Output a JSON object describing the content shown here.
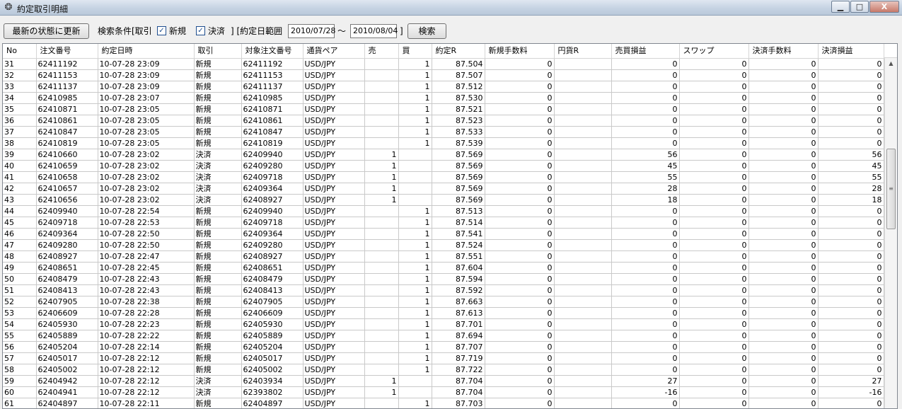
{
  "window": {
    "title": "約定取引明細",
    "icon": "app-icon",
    "minimize": "▁",
    "maximize": "□",
    "close": "X"
  },
  "toolbar": {
    "refresh_label": "最新の状態に更新",
    "filter_label": "検索条件[取引",
    "new_label": "新規",
    "settle_label": "決済",
    "range_label": "] [約定日範囲",
    "date_from": "2010/07/28",
    "tilde": "～",
    "date_to": "2010/08/04",
    "range_close": "]",
    "search_label": "検索",
    "checkbox_mark": "✓"
  },
  "table": {
    "columns": [
      "No",
      "注文番号",
      "約定日時",
      "取引",
      "対象注文番号",
      "通貨ペア",
      "売",
      "買",
      "約定R",
      "新規手数料",
      "円貨R",
      "売買損益",
      "スワップ",
      "決済手数料",
      "決済損益"
    ],
    "rows": [
      [
        "31",
        "62411192",
        "10-07-28 23:09",
        "新規",
        "62411192",
        "USD/JPY",
        "",
        "1",
        "87.504",
        "0",
        "",
        "0",
        "0",
        "0",
        "0"
      ],
      [
        "32",
        "62411153",
        "10-07-28 23:09",
        "新規",
        "62411153",
        "USD/JPY",
        "",
        "1",
        "87.507",
        "0",
        "",
        "0",
        "0",
        "0",
        "0"
      ],
      [
        "33",
        "62411137",
        "10-07-28 23:09",
        "新規",
        "62411137",
        "USD/JPY",
        "",
        "1",
        "87.512",
        "0",
        "",
        "0",
        "0",
        "0",
        "0"
      ],
      [
        "34",
        "62410985",
        "10-07-28 23:07",
        "新規",
        "62410985",
        "USD/JPY",
        "",
        "1",
        "87.530",
        "0",
        "",
        "0",
        "0",
        "0",
        "0"
      ],
      [
        "35",
        "62410871",
        "10-07-28 23:05",
        "新規",
        "62410871",
        "USD/JPY",
        "",
        "1",
        "87.521",
        "0",
        "",
        "0",
        "0",
        "0",
        "0"
      ],
      [
        "36",
        "62410861",
        "10-07-28 23:05",
        "新規",
        "62410861",
        "USD/JPY",
        "",
        "1",
        "87.523",
        "0",
        "",
        "0",
        "0",
        "0",
        "0"
      ],
      [
        "37",
        "62410847",
        "10-07-28 23:05",
        "新規",
        "62410847",
        "USD/JPY",
        "",
        "1",
        "87.533",
        "0",
        "",
        "0",
        "0",
        "0",
        "0"
      ],
      [
        "38",
        "62410819",
        "10-07-28 23:05",
        "新規",
        "62410819",
        "USD/JPY",
        "",
        "1",
        "87.539",
        "0",
        "",
        "0",
        "0",
        "0",
        "0"
      ],
      [
        "39",
        "62410660",
        "10-07-28 23:02",
        "決済",
        "62409940",
        "USD/JPY",
        "1",
        "",
        "87.569",
        "0",
        "",
        "56",
        "0",
        "0",
        "56"
      ],
      [
        "40",
        "62410659",
        "10-07-28 23:02",
        "決済",
        "62409280",
        "USD/JPY",
        "1",
        "",
        "87.569",
        "0",
        "",
        "45",
        "0",
        "0",
        "45"
      ],
      [
        "41",
        "62410658",
        "10-07-28 23:02",
        "決済",
        "62409718",
        "USD/JPY",
        "1",
        "",
        "87.569",
        "0",
        "",
        "55",
        "0",
        "0",
        "55"
      ],
      [
        "42",
        "62410657",
        "10-07-28 23:02",
        "決済",
        "62409364",
        "USD/JPY",
        "1",
        "",
        "87.569",
        "0",
        "",
        "28",
        "0",
        "0",
        "28"
      ],
      [
        "43",
        "62410656",
        "10-07-28 23:02",
        "決済",
        "62408927",
        "USD/JPY",
        "1",
        "",
        "87.569",
        "0",
        "",
        "18",
        "0",
        "0",
        "18"
      ],
      [
        "44",
        "62409940",
        "10-07-28 22:54",
        "新規",
        "62409940",
        "USD/JPY",
        "",
        "1",
        "87.513",
        "0",
        "",
        "0",
        "0",
        "0",
        "0"
      ],
      [
        "45",
        "62409718",
        "10-07-28 22:53",
        "新規",
        "62409718",
        "USD/JPY",
        "",
        "1",
        "87.514",
        "0",
        "",
        "0",
        "0",
        "0",
        "0"
      ],
      [
        "46",
        "62409364",
        "10-07-28 22:50",
        "新規",
        "62409364",
        "USD/JPY",
        "",
        "1",
        "87.541",
        "0",
        "",
        "0",
        "0",
        "0",
        "0"
      ],
      [
        "47",
        "62409280",
        "10-07-28 22:50",
        "新規",
        "62409280",
        "USD/JPY",
        "",
        "1",
        "87.524",
        "0",
        "",
        "0",
        "0",
        "0",
        "0"
      ],
      [
        "48",
        "62408927",
        "10-07-28 22:47",
        "新規",
        "62408927",
        "USD/JPY",
        "",
        "1",
        "87.551",
        "0",
        "",
        "0",
        "0",
        "0",
        "0"
      ],
      [
        "49",
        "62408651",
        "10-07-28 22:45",
        "新規",
        "62408651",
        "USD/JPY",
        "",
        "1",
        "87.604",
        "0",
        "",
        "0",
        "0",
        "0",
        "0"
      ],
      [
        "50",
        "62408479",
        "10-07-28 22:43",
        "新規",
        "62408479",
        "USD/JPY",
        "",
        "1",
        "87.594",
        "0",
        "",
        "0",
        "0",
        "0",
        "0"
      ],
      [
        "51",
        "62408413",
        "10-07-28 22:43",
        "新規",
        "62408413",
        "USD/JPY",
        "",
        "1",
        "87.592",
        "0",
        "",
        "0",
        "0",
        "0",
        "0"
      ],
      [
        "52",
        "62407905",
        "10-07-28 22:38",
        "新規",
        "62407905",
        "USD/JPY",
        "",
        "1",
        "87.663",
        "0",
        "",
        "0",
        "0",
        "0",
        "0"
      ],
      [
        "53",
        "62406609",
        "10-07-28 22:28",
        "新規",
        "62406609",
        "USD/JPY",
        "",
        "1",
        "87.613",
        "0",
        "",
        "0",
        "0",
        "0",
        "0"
      ],
      [
        "54",
        "62405930",
        "10-07-28 22:23",
        "新規",
        "62405930",
        "USD/JPY",
        "",
        "1",
        "87.701",
        "0",
        "",
        "0",
        "0",
        "0",
        "0"
      ],
      [
        "55",
        "62405889",
        "10-07-28 22:22",
        "新規",
        "62405889",
        "USD/JPY",
        "",
        "1",
        "87.694",
        "0",
        "",
        "0",
        "0",
        "0",
        "0"
      ],
      [
        "56",
        "62405204",
        "10-07-28 22:14",
        "新規",
        "62405204",
        "USD/JPY",
        "",
        "1",
        "87.707",
        "0",
        "",
        "0",
        "0",
        "0",
        "0"
      ],
      [
        "57",
        "62405017",
        "10-07-28 22:12",
        "新規",
        "62405017",
        "USD/JPY",
        "",
        "1",
        "87.719",
        "0",
        "",
        "0",
        "0",
        "0",
        "0"
      ],
      [
        "58",
        "62405002",
        "10-07-28 22:12",
        "新規",
        "62405002",
        "USD/JPY",
        "",
        "1",
        "87.722",
        "0",
        "",
        "0",
        "0",
        "0",
        "0"
      ],
      [
        "59",
        "62404942",
        "10-07-28 22:12",
        "決済",
        "62403934",
        "USD/JPY",
        "1",
        "",
        "87.704",
        "0",
        "",
        "27",
        "0",
        "0",
        "27"
      ],
      [
        "60",
        "62404941",
        "10-07-28 22:12",
        "決済",
        "62393802",
        "USD/JPY",
        "1",
        "",
        "87.704",
        "0",
        "",
        "-16",
        "0",
        "0",
        "-16"
      ],
      [
        "61",
        "62404897",
        "10-07-28 22:11",
        "新規",
        "62404897",
        "USD/JPY",
        "",
        "1",
        "87.703",
        "0",
        "",
        "0",
        "0",
        "0",
        "0"
      ]
    ]
  },
  "scrollbar": {
    "up": "▲",
    "grip": "≡"
  }
}
